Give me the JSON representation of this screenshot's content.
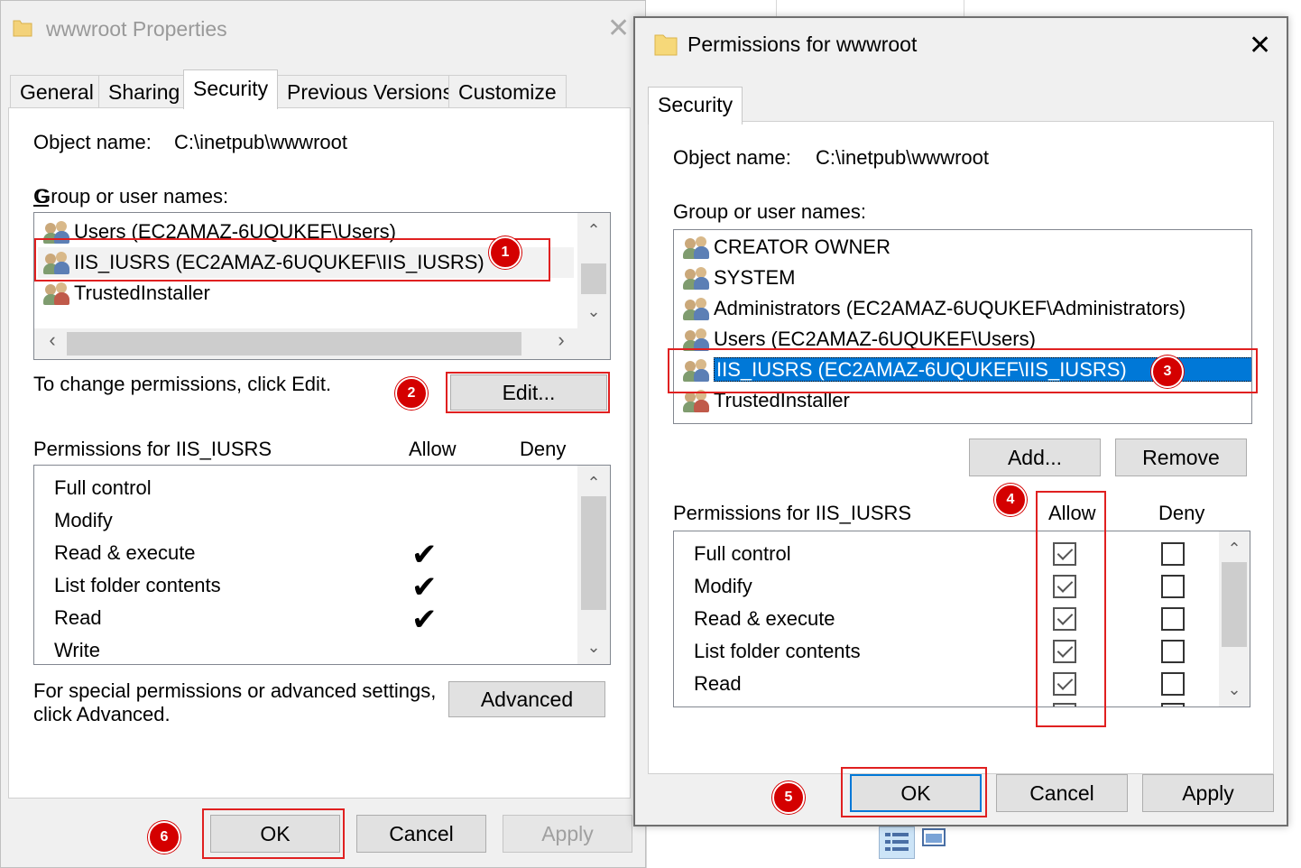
{
  "dialog1": {
    "title": "wwwroot Properties",
    "tabs": [
      "General",
      "Sharing",
      "Security",
      "Previous Versions",
      "Customize"
    ],
    "active_tab": "Security",
    "object_name_label": "Object name:",
    "object_name_value": "C:\\inetpub\\wwwroot",
    "group_label": "Group or user names:",
    "users": [
      "Users (EC2AMAZ-6UQUKEF\\Users)",
      "IIS_IUSRS (EC2AMAZ-6UQUKEF\\IIS_IUSRS)",
      "TrustedInstaller"
    ],
    "change_text": "To change permissions, click Edit.",
    "edit_button": "Edit...",
    "perm_header": "Permissions for IIS_IUSRS",
    "allow_header": "Allow",
    "deny_header": "Deny",
    "permissions": [
      "Full control",
      "Modify",
      "Read & execute",
      "List folder contents",
      "Read",
      "Write"
    ],
    "allowed_mark": "✔",
    "special_text_1": "For special permissions or advanced settings,",
    "special_text_2": "click Advanced.",
    "advanced_button": "Advanced",
    "ok_button": "OK",
    "cancel_button": "Cancel",
    "apply_button": "Apply"
  },
  "dialog2": {
    "title": "Permissions for wwwroot",
    "tab": "Security",
    "object_name_label": "Object name:",
    "object_name_value": "C:\\inetpub\\wwwroot",
    "group_label": "Group or user names:",
    "users": [
      "CREATOR OWNER",
      "SYSTEM",
      "Administrators (EC2AMAZ-6UQUKEF\\Administrators)",
      "Users (EC2AMAZ-6UQUKEF\\Users)",
      "IIS_IUSRS (EC2AMAZ-6UQUKEF\\IIS_IUSRS)",
      "TrustedInstaller"
    ],
    "selected_user": "IIS_IUSRS (EC2AMAZ-6UQUKEF\\IIS_IUSRS)",
    "add_button": "Add...",
    "remove_button": "Remove",
    "perm_header": "Permissions for IIS_IUSRS",
    "allow_header": "Allow",
    "deny_header": "Deny",
    "permissions": [
      "Full control",
      "Modify",
      "Read & execute",
      "List folder contents",
      "Read"
    ],
    "ok_button": "OK",
    "cancel_button": "Cancel",
    "apply_button": "Apply"
  },
  "badges": [
    "1",
    "2",
    "3",
    "4",
    "5",
    "6"
  ],
  "colors": {
    "highlight_red": "#e02020",
    "badge_red": "#d40000",
    "selection_blue": "#0078d7"
  }
}
